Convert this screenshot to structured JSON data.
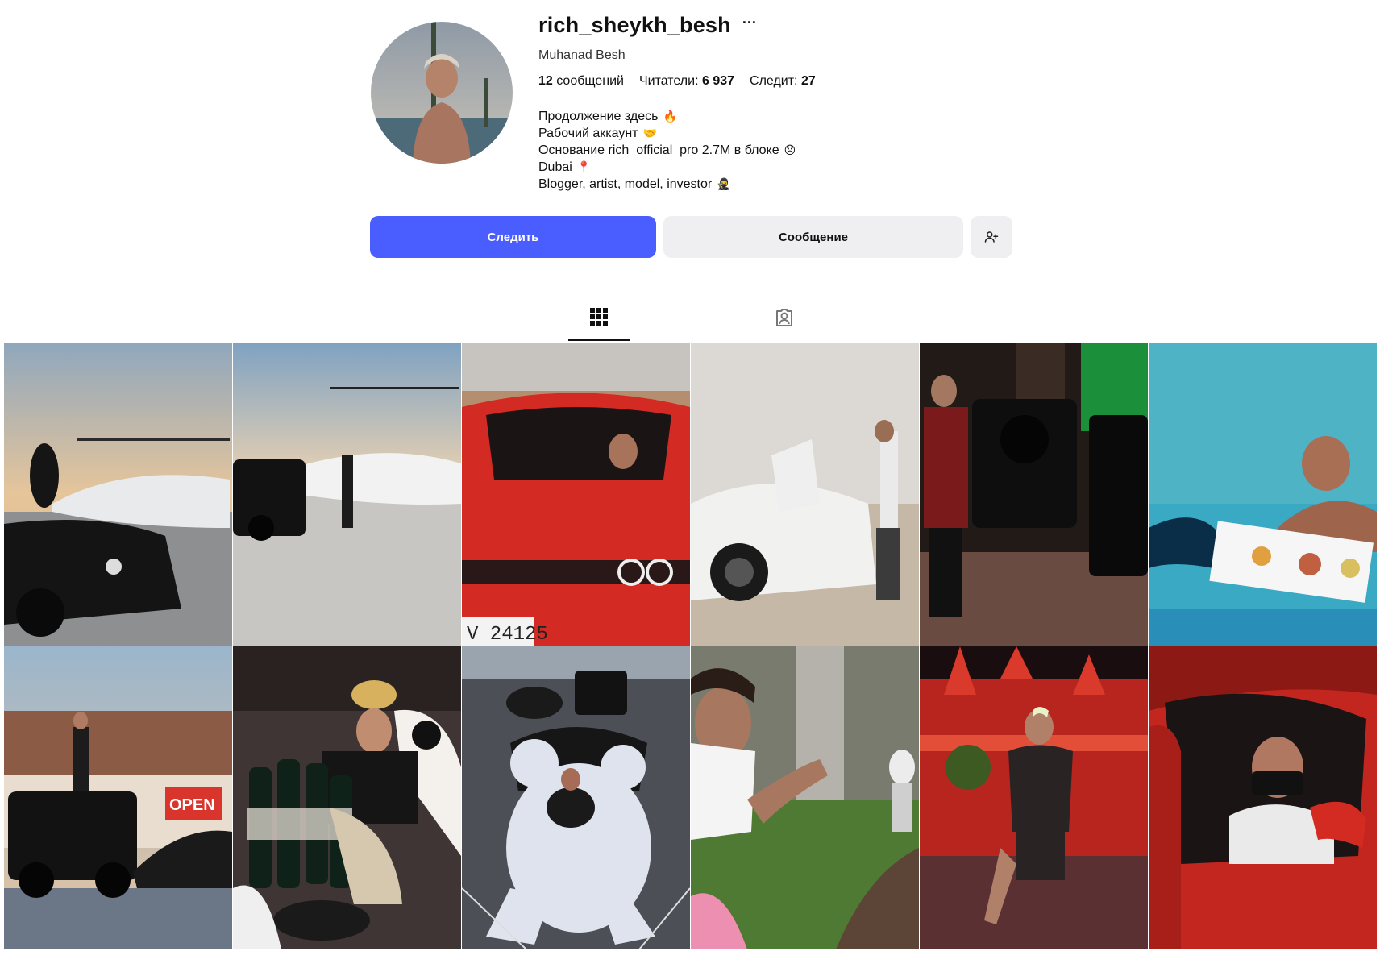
{
  "profile": {
    "username": "rich_sheykh_besh",
    "more_icon": "ellipsis-icon",
    "full_name": "Muhanad Besh",
    "stats": {
      "posts_count": "12",
      "posts_label": "сообщений",
      "followers_label": "Читатели:",
      "followers_count": "6 937",
      "following_label": "Следит:",
      "following_count": "27"
    },
    "bio": [
      {
        "text": "Продолжение здесь",
        "emoji": "🔥"
      },
      {
        "text": "Рабочий аккаунт",
        "emoji": "🤝"
      },
      {
        "text": "Основание rich_official_pro 2.7M в блоке",
        "emoji": "😞"
      },
      {
        "text": "Dubai",
        "emoji": "📍"
      },
      {
        "text": "Blogger, artist, model, investor",
        "emoji": "🥷"
      }
    ]
  },
  "actions": {
    "follow_label": "Следить",
    "message_label": "Сообщение",
    "add_user_icon": "add-person-icon"
  },
  "tabs": {
    "posts_icon": "grid-icon",
    "tagged_icon": "tagged-person-icon",
    "active": "posts"
  },
  "colors": {
    "accent": "#4a5dff",
    "secondary_button": "#efeff2"
  },
  "posts": [
    {
      "id": 1,
      "scene": "man sitting on black SUV in front of helicopter at sunset"
    },
    {
      "id": 2,
      "scene": "man standing beside black SUV and helicopter"
    },
    {
      "id": 3,
      "scene": "man in red sports car, plate V 24125"
    },
    {
      "id": 4,
      "scene": "man standing by white supercar with open doors in desert"
    },
    {
      "id": 5,
      "scene": "man with black SUVs at night gas station"
    },
    {
      "id": 6,
      "scene": "man in pool with floating breakfast tray"
    },
    {
      "id": 7,
      "scene": "man standing on black SUV at storefront with OPEN sign"
    },
    {
      "id": 8,
      "scene": "man in bucket hat with champagne bottles and skull decor"
    },
    {
      "id": 9,
      "scene": "man on giant white teddy bear in front of sports car"
    },
    {
      "id": 10,
      "scene": "man feeding lemur outdoors"
    },
    {
      "id": 11,
      "scene": "man posing in front of illuminated red castle at night"
    },
    {
      "id": 12,
      "scene": "man wearing mask in red sports car"
    }
  ]
}
